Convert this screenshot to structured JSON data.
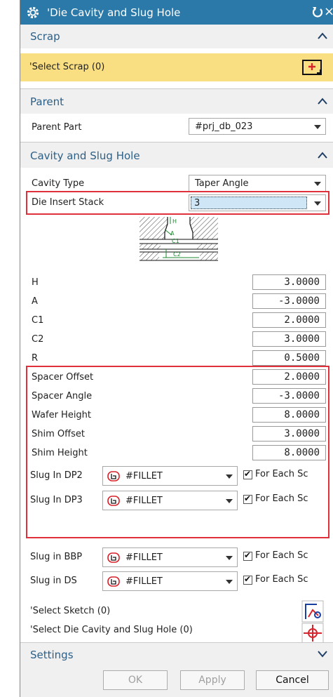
{
  "dialog": {
    "title": "'Die Cavity and Slug Hole",
    "close_symbol": "×"
  },
  "scrap": {
    "header": "Scrap",
    "select_label": "'Select Scrap (0)"
  },
  "parent": {
    "header": "Parent",
    "part_label": "Parent Part",
    "part_value": "#prj_db_023"
  },
  "cavity": {
    "header": "Cavity and Slug Hole",
    "cavity_type_label": "Cavity Type",
    "cavity_type_value": "Taper Angle",
    "die_insert_stack_label": "Die Insert Stack",
    "die_insert_stack_value": "3",
    "diagram_labels": {
      "h": "H",
      "a": "A",
      "c1": "C1",
      "c2": "C2"
    },
    "params": [
      {
        "label": "H",
        "value": "3.0000"
      },
      {
        "label": "A",
        "value": "-3.0000"
      },
      {
        "label": "C1",
        "value": "2.0000"
      },
      {
        "label": "C2",
        "value": "3.0000"
      },
      {
        "label": "R",
        "value": "0.5000"
      }
    ],
    "spacer_params": [
      {
        "label": "Spacer Offset",
        "value": "2.0000"
      },
      {
        "label": "Spacer Angle",
        "value": "-3.0000"
      },
      {
        "label": "Wafer Height",
        "value": "8.0000"
      },
      {
        "label": "Shim Offset",
        "value": "3.0000"
      },
      {
        "label": "Shim Height",
        "value": "8.0000"
      }
    ],
    "slug_rows": [
      {
        "label": "Slug In DP2",
        "value": "#FILLET",
        "check_label": "For Each Sc",
        "checked": true
      },
      {
        "label": "Slug In DP3",
        "value": "#FILLET",
        "check_label": "For Each Sc",
        "checked": true
      },
      {
        "label": "Slug in BBP",
        "value": "#FILLET",
        "check_label": "For Each Sc",
        "checked": true
      },
      {
        "label": "Slug in DS",
        "value": "#FILLET",
        "check_label": "For Each Sc",
        "checked": true
      }
    ],
    "select_sketch_label": "'Select Sketch (0)",
    "select_cavity_label": "'Select Die Cavity and Slug Hole (0)"
  },
  "settings": {
    "header": "Settings"
  },
  "buttons": {
    "ok": "OK",
    "apply": "Apply",
    "cancel": "Cancel"
  },
  "colors": {
    "title_bar": "#2a79a8",
    "section_header_text": "#2d5f86",
    "selection_highlight": "#fadf82",
    "highlight_box": "#e0303c",
    "icon_red": "#d8242c"
  },
  "icons": [
    "gear-icon",
    "reset-icon",
    "close-icon",
    "chevron-up-icon",
    "chevron-down-icon",
    "add-scrap-icon",
    "fillet-icon",
    "sketch-icon",
    "point-target-icon"
  ]
}
